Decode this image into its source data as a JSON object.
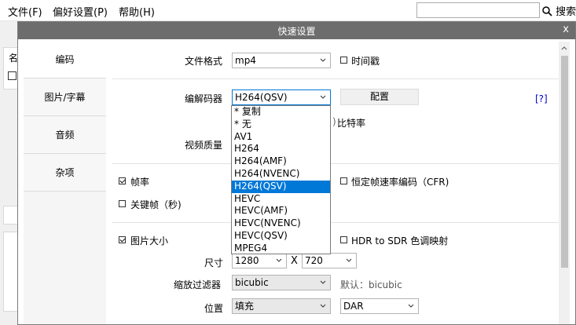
{
  "menubar": {
    "file": "文件(F)",
    "prefs": "偏好设置(P)",
    "help": "帮助(H)",
    "search": "搜索"
  },
  "background": {
    "col_header": "名"
  },
  "dialog": {
    "title": "快速设置",
    "close": "x",
    "nav": [
      "编码",
      "图片/字幕",
      "音频",
      "杂项"
    ],
    "file_format": {
      "label": "文件格式",
      "value": "mp4",
      "timestamp": "时间戳"
    },
    "codec": {
      "label": "编解码器",
      "value": "H264(QSV)",
      "config": "配置",
      "help": "[?]"
    },
    "bitrate_label": "比特率",
    "quality_label": "视频质量",
    "framerate": {
      "label": "帧率",
      "cfr": "恒定帧速率编码（CFR)"
    },
    "keyframe_label": "关键帧（秒)",
    "picsize": {
      "label": "图片大小",
      "hdr": "HDR to SDR 色调映射"
    },
    "size": {
      "label": "尺寸",
      "width": "1280",
      "x": "X",
      "height": "720"
    },
    "scale_filter": {
      "label": "缩放过滤器",
      "value": "bicubic",
      "default_text": "默认：bicubic"
    },
    "position": {
      "label": "位置",
      "value": "填充",
      "dar": "DAR"
    }
  },
  "codec_options": [
    "* 复制",
    "* 无",
    "AV1",
    "H264",
    "H264(AMF)",
    "H264(NVENC)",
    "H264(QSV)",
    "HEVC",
    "HEVC(AMF)",
    "HEVC(NVENC)",
    "HEVC(QSV)",
    "MPEG4"
  ],
  "selected_codec": "H264(QSV)"
}
